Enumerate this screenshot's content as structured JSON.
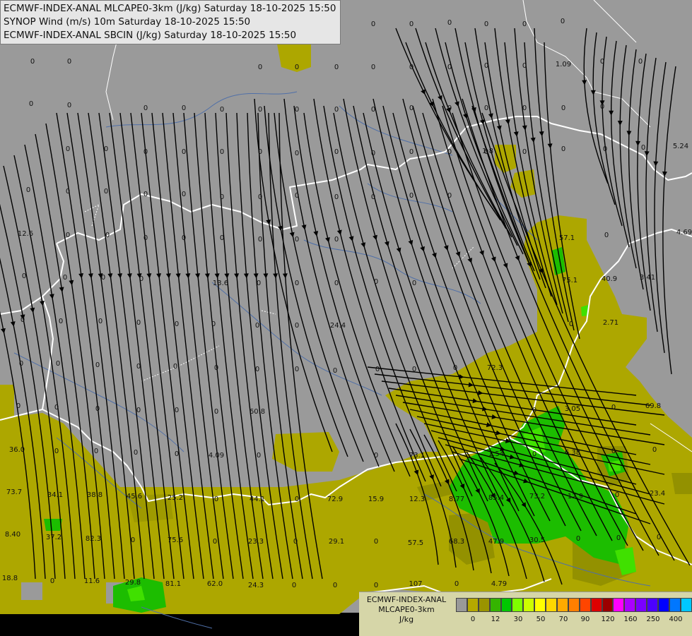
{
  "header": {
    "line1": "ECMWF-INDEX-ANAL MLCAPE0-3km (J/kg) Saturday 18-10-2025 15:50",
    "line2": "SYNOP Wind (m/s) 10m Saturday 18-10-2025 15:50",
    "line3": "ECMWF-INDEX-ANAL SBCIN (J/kg) Saturday 18-10-2025 15:50"
  },
  "legend": {
    "title1": "ECMWF-INDEX-ANAL",
    "title2": "MLCAPE0-3km",
    "unit": "J/kg",
    "colors": [
      "#999999",
      "#b5a800",
      "#9a9400",
      "#35b400",
      "#00c800",
      "#7fff00",
      "#ccff00",
      "#ffff00",
      "#ffd700",
      "#ffaa00",
      "#ff7f00",
      "#ff4500",
      "#dd0000",
      "#9b0000",
      "#ff00ff",
      "#aa00ff",
      "#7a00ff",
      "#4b00ff",
      "#0000ff",
      "#0077ff",
      "#00c8ff",
      "#66ffff",
      "#ffffff"
    ],
    "ticks": [
      "0",
      "12",
      "30",
      "50",
      "70",
      "90",
      "120",
      "160",
      "250",
      "400"
    ]
  },
  "labels": [
    {
      "t": "0"
    },
    {
      "t": "0"
    },
    {
      "t": "0"
    },
    {
      "t": "0"
    },
    {
      "t": "0"
    },
    {
      "t": "0"
    },
    {
      "t": "0"
    },
    {
      "t": "0"
    },
    {
      "t": "0"
    },
    {
      "t": "0"
    },
    {
      "t": "0"
    },
    {
      "t": "0"
    },
    {
      "t": "0"
    },
    {
      "t": "0"
    },
    {
      "t": "0"
    },
    {
      "t": "0"
    },
    {
      "t": "0"
    },
    {
      "t": "0"
    },
    {
      "t": "1.09"
    },
    {
      "t": "0"
    },
    {
      "t": "0"
    },
    {
      "t": "0"
    },
    {
      "t": "0"
    },
    {
      "t": "0"
    },
    {
      "t": "0"
    },
    {
      "t": "0"
    },
    {
      "t": "0"
    },
    {
      "t": "0"
    },
    {
      "t": "0"
    },
    {
      "t": "0"
    },
    {
      "t": "0"
    },
    {
      "t": "0"
    },
    {
      "t": "0"
    },
    {
      "t": "0"
    },
    {
      "t": "0"
    },
    {
      "t": "0"
    },
    {
      "t": "0"
    },
    {
      "t": "0"
    },
    {
      "t": "0"
    },
    {
      "t": "0"
    },
    {
      "t": "0"
    },
    {
      "t": "0"
    },
    {
      "t": "0"
    },
    {
      "t": "0"
    },
    {
      "t": "0"
    },
    {
      "t": "0"
    },
    {
      "t": "0"
    },
    {
      "t": "0"
    },
    {
      "t": "1.8"
    },
    {
      "t": "0"
    },
    {
      "t": "0"
    },
    {
      "t": "5.24"
    },
    {
      "t": "0"
    },
    {
      "t": "0"
    },
    {
      "t": "0"
    },
    {
      "t": "0"
    },
    {
      "t": "0"
    },
    {
      "t": "0"
    },
    {
      "t": "0"
    },
    {
      "t": "0"
    },
    {
      "t": "0"
    },
    {
      "t": "0"
    },
    {
      "t": "0"
    },
    {
      "t": "0"
    },
    {
      "t": "12.6"
    },
    {
      "t": "0"
    },
    {
      "t": "0"
    },
    {
      "t": "0"
    },
    {
      "t": "0"
    },
    {
      "t": "0"
    },
    {
      "t": "0"
    },
    {
      "t": "0"
    },
    {
      "t": "0"
    },
    {
      "t": "57.1"
    },
    {
      "t": "0"
    },
    {
      "t": "4.69"
    },
    {
      "t": "0"
    },
    {
      "t": "0"
    },
    {
      "t": "0"
    },
    {
      "t": "0"
    },
    {
      "t": "13.6"
    },
    {
      "t": "0"
    },
    {
      "t": "0"
    },
    {
      "t": "0"
    },
    {
      "t": "0"
    },
    {
      "t": "0"
    },
    {
      "t": "75.1"
    },
    {
      "t": "40.9"
    },
    {
      "t": "3.41"
    },
    {
      "t": "0"
    },
    {
      "t": "0"
    },
    {
      "t": "0"
    },
    {
      "t": "0"
    },
    {
      "t": "0"
    },
    {
      "t": "0"
    },
    {
      "t": "0"
    },
    {
      "t": "0"
    },
    {
      "t": "24.4"
    },
    {
      "t": "0"
    },
    {
      "t": "2.71"
    },
    {
      "t": "0"
    },
    {
      "t": "0"
    },
    {
      "t": "0"
    },
    {
      "t": "0"
    },
    {
      "t": "0"
    },
    {
      "t": "0"
    },
    {
      "t": "0"
    },
    {
      "t": "0"
    },
    {
      "t": "0"
    },
    {
      "t": "0"
    },
    {
      "t": "0"
    },
    {
      "t": "0"
    },
    {
      "t": "72.3"
    },
    {
      "t": "0"
    },
    {
      "t": "0"
    },
    {
      "t": "0"
    },
    {
      "t": "0"
    },
    {
      "t": "0"
    },
    {
      "t": "0"
    },
    {
      "t": "60.8"
    },
    {
      "t": "0"
    },
    {
      "t": "3.05"
    },
    {
      "t": "0"
    },
    {
      "t": "69.8"
    },
    {
      "t": "36.0"
    },
    {
      "t": "0"
    },
    {
      "t": "0"
    },
    {
      "t": "0"
    },
    {
      "t": "0"
    },
    {
      "t": "4.09"
    },
    {
      "t": "0"
    },
    {
      "t": "0"
    },
    {
      "t": "73.1"
    },
    {
      "t": "1.54"
    },
    {
      "t": "0"
    },
    {
      "t": "6.38"
    },
    {
      "t": "0"
    },
    {
      "t": "0"
    },
    {
      "t": "73.7"
    },
    {
      "t": "34.1"
    },
    {
      "t": "38.8"
    },
    {
      "t": "45.6"
    },
    {
      "t": "25.2"
    },
    {
      "t": "0"
    },
    {
      "t": "44.1"
    },
    {
      "t": "0"
    },
    {
      "t": "72.9"
    },
    {
      "t": "15.9"
    },
    {
      "t": "12.3"
    },
    {
      "t": "8.77"
    },
    {
      "t": "85.4"
    },
    {
      "t": "73.2"
    },
    {
      "t": "12.9"
    },
    {
      "t": "0"
    },
    {
      "t": "23.4"
    },
    {
      "t": "8.40"
    },
    {
      "t": "37.2"
    },
    {
      "t": "82.3"
    },
    {
      "t": "0"
    },
    {
      "t": "75.6"
    },
    {
      "t": "0"
    },
    {
      "t": "23.3"
    },
    {
      "t": "0"
    },
    {
      "t": "29.1"
    },
    {
      "t": "0"
    },
    {
      "t": "57.5"
    },
    {
      "t": "68.3"
    },
    {
      "t": "47.9"
    },
    {
      "t": "30.5"
    },
    {
      "t": "0"
    },
    {
      "t": "0"
    },
    {
      "t": "0"
    },
    {
      "t": "18.8"
    },
    {
      "t": "0"
    },
    {
      "t": "11.6"
    },
    {
      "t": "29.8"
    },
    {
      "t": "81.1"
    },
    {
      "t": "62.0"
    },
    {
      "t": "24.3"
    },
    {
      "t": "0"
    },
    {
      "t": "0"
    },
    {
      "t": "0"
    },
    {
      "t": "107"
    },
    {
      "t": "0"
    },
    {
      "t": "4.79"
    }
  ]
}
